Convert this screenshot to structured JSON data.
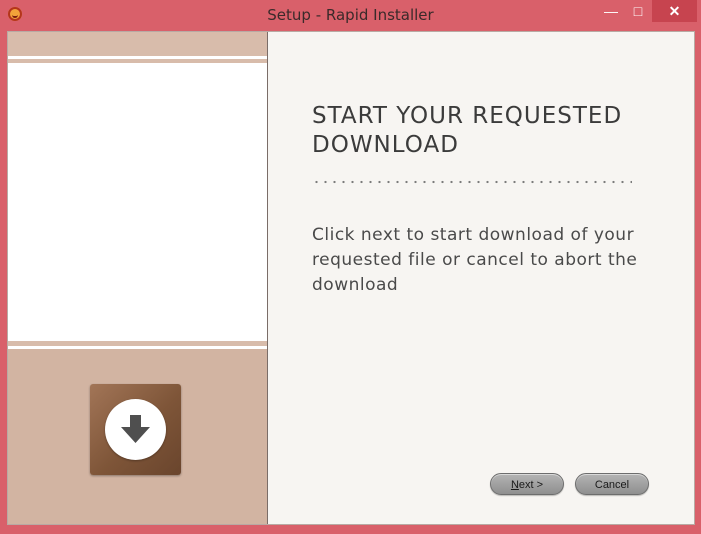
{
  "window": {
    "title": "Setup - Rapid Installer",
    "controls": {
      "minimize": "—",
      "maximize": "□",
      "close": "✕"
    }
  },
  "content": {
    "heading": "START YOUR REQUESTED DOWNLOAD",
    "description": "Click next to start download of your requested file or cancel to abort the download"
  },
  "buttons": {
    "next_accel": "N",
    "next_rest": "ext >",
    "cancel": "Cancel"
  },
  "icons": {
    "app": "installer-app-icon",
    "download": "download-arrow-icon"
  },
  "colors": {
    "frame": "#d9606a",
    "close": "#c7444f",
    "panel_tan": "#d8bcab",
    "tile_brown": "#7e5538"
  }
}
